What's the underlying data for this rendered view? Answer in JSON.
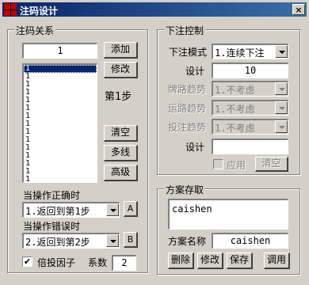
{
  "window": {
    "title": "注码设计",
    "close_label": "×"
  },
  "left": {
    "group_label": "注码关系",
    "input_value": "1",
    "add_label": "添加",
    "modify_label": "修改",
    "step_label": "第1步",
    "clear_label": "清空",
    "multiline_label": "多线",
    "advanced_label": "高级",
    "list_items": [
      "1",
      "1",
      "1",
      "1",
      "1",
      "1",
      "1",
      "1",
      "1",
      "1",
      "1",
      "1",
      "1",
      "1",
      "1"
    ],
    "on_correct_label": "当操作正确时",
    "on_correct_value": "1.返回到第1步",
    "btn_a_label": "A",
    "on_error_label": "当操作错误时",
    "on_error_value": "2.返回到第2步",
    "btn_b_label": "B",
    "multiplier_label": "倍投因子",
    "multiplier_checked": "✔",
    "coef_label": "系数",
    "coef_value": "2"
  },
  "right": {
    "group_label": "下注控制",
    "bet_mode_label": "下注模式",
    "bet_mode_value": "1.连续下注",
    "design_label": "设计",
    "design_value": "10",
    "card_trend_label": "牌路趋势",
    "card_trend_value": "1.不考虑",
    "luck_trend_label": "运路趋势",
    "luck_trend_value": "1.不考虑",
    "bet_trend_label": "投注趋势",
    "bet_trend_value": "1.不考虑",
    "design2_label": "设计",
    "design2_value": "",
    "apply_label": "应用",
    "clear_label": "清空"
  },
  "scheme": {
    "group_label": "方案存取",
    "list_value": "caishen",
    "name_label": "方案名称",
    "name_value": "caishen",
    "delete_label": "删除",
    "modify_label": "修改",
    "save_label": "保存",
    "load_label": "调用"
  }
}
